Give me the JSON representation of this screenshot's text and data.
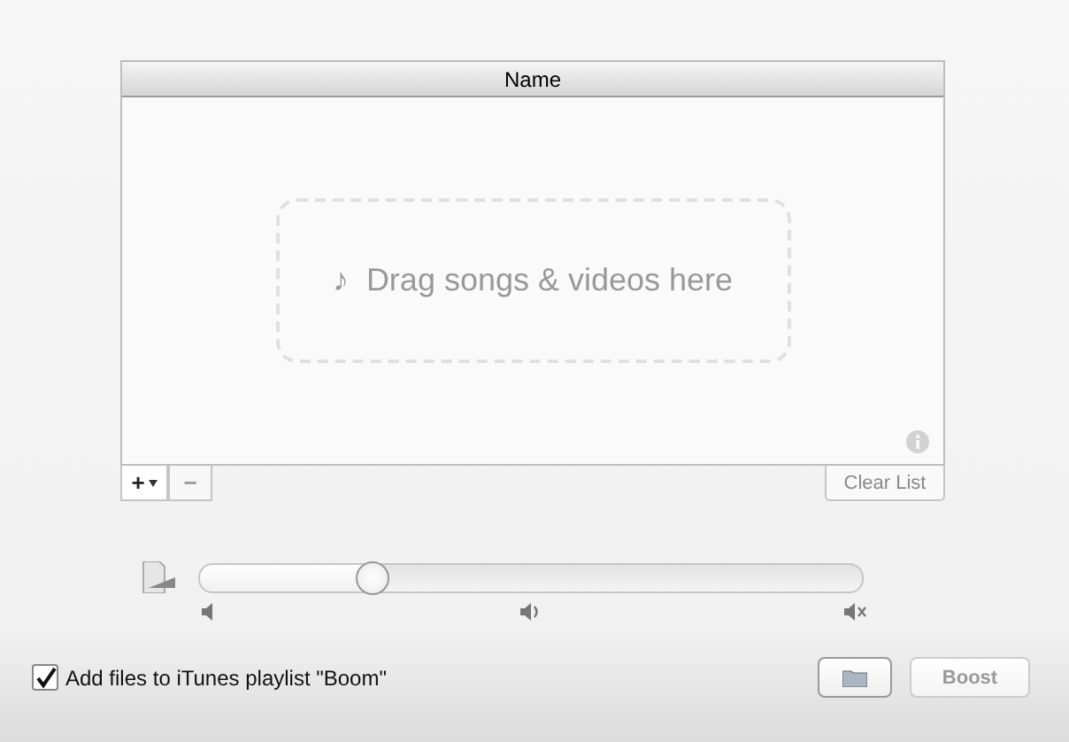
{
  "table": {
    "columns": [
      "Name"
    ],
    "drop_zone": {
      "icon": "♪",
      "text": "Drag songs & videos here"
    }
  },
  "list_buttons": [
    {
      "label": "+",
      "kind": "menu"
    },
    {
      "label": "−",
      "kind": "plain"
    }
  ],
  "clear_button": {
    "label": "Clear List",
    "disabled": true
  },
  "volume": {
    "level": 0.26
  },
  "playlist_option": {
    "label": "Add files to iTunes playlist \"Boom\"",
    "checked": true
  },
  "boost_button": {
    "label": "Boost",
    "disabled": true
  }
}
